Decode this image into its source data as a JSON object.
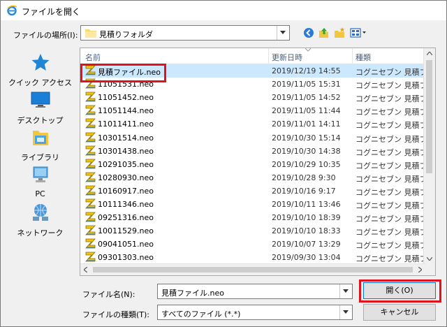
{
  "title": "ファイルを開く",
  "location": {
    "label": "ファイルの場所(I):",
    "value": "見積りフォルダ"
  },
  "places": [
    {
      "label": "クイック アクセス",
      "icon": "star-icon"
    },
    {
      "label": "デスクトップ",
      "icon": "desktop-icon"
    },
    {
      "label": "ライブラリ",
      "icon": "library-icon"
    },
    {
      "label": "PC",
      "icon": "computer-icon"
    },
    {
      "label": "ネットワーク",
      "icon": "network-icon"
    }
  ],
  "columns": {
    "name": "名前",
    "date": "更新日時",
    "type": "種類"
  },
  "files": [
    {
      "name": "見積ファイル.neo",
      "date": "2019/12/19 14:55",
      "type": "コグニセブン 見積ファ..."
    },
    {
      "name": "11051531.neo",
      "date": "2019/11/05 15:31",
      "type": "コグニセブン 見積ファ..."
    },
    {
      "name": "11051452.neo",
      "date": "2019/11/05 14:52",
      "type": "コグニセブン 見積ファ..."
    },
    {
      "name": "11051144.neo",
      "date": "2019/11/05 11:44",
      "type": "コグニセブン 見積ファ..."
    },
    {
      "name": "11011411.neo",
      "date": "2019/11/01 14:11",
      "type": "コグニセブン 見積ファ..."
    },
    {
      "name": "10301514.neo",
      "date": "2019/10/30 15:14",
      "type": "コグニセブン 見積ファ..."
    },
    {
      "name": "10301438.neo",
      "date": "2019/10/30 14:38",
      "type": "コグニセブン 見積ファ..."
    },
    {
      "name": "10291035.neo",
      "date": "2019/10/29 10:35",
      "type": "コグニセブン 見積ファ..."
    },
    {
      "name": "10280930.neo",
      "date": "2019/10/28 9:30",
      "type": "コグニセブン 見積ファ..."
    },
    {
      "name": "10160917.neo",
      "date": "2019/10/16 9:17",
      "type": "コグニセブン 見積ファ..."
    },
    {
      "name": "10111346.neo",
      "date": "2019/10/11 13:46",
      "type": "コグニセブン 見積ファ..."
    },
    {
      "name": "09251316.neo",
      "date": "2019/10/10 18:39",
      "type": "コグニセブン 見積ファ..."
    },
    {
      "name": "10011529.neo",
      "date": "2019/10/10 18:33",
      "type": "コグニセブン 見積ファ..."
    },
    {
      "name": "09041051.neo",
      "date": "2019/10/07 13:29",
      "type": "コグニセブン 見積ファ..."
    },
    {
      "name": "09301303.neo",
      "date": "2019/09/30 13:04",
      "type": "コグニセブン 見積ファ..."
    }
  ],
  "filename": {
    "label": "ファイル名(N):",
    "value": "見積ファイル.neo"
  },
  "filetype": {
    "label": "ファイルの種類(T):",
    "value": "すべてのファイル (*.*)"
  },
  "buttons": {
    "open": "開く(O)",
    "cancel": "キャンセル"
  },
  "colors": {
    "highlight": "#e0121b",
    "selection": "#cce8ff",
    "accent": "#0078d7"
  }
}
